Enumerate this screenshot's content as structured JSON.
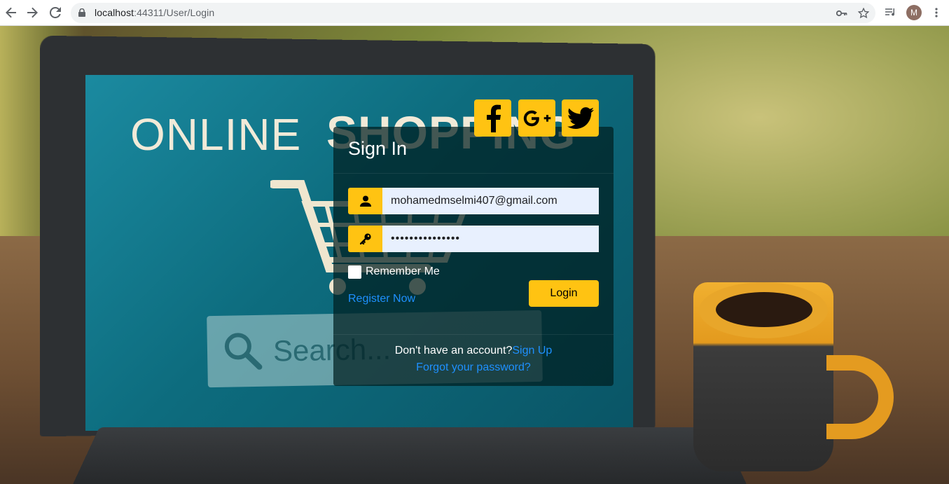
{
  "browser": {
    "url_host": "localhost",
    "url_rest": ":44311/User/Login",
    "profile_initial": "M"
  },
  "background": {
    "screen_text_online": "ONLINE",
    "screen_text_shopping": "SHOPPING",
    "screen_search_text": "Search..."
  },
  "login": {
    "title": "Sign In",
    "username_value": "mohamedmselmi407@gmail.com",
    "password_value": "•••••••••••••••",
    "remember_label": "Remember Me",
    "login_button": "Login",
    "register_link": "Register Now",
    "no_account_text": "Don't have an account?",
    "signup_link": "Sign Up",
    "forgot_link": "Forgot your password?"
  },
  "colors": {
    "accent": "#ffc312",
    "link": "#1e90ff",
    "panel": "rgba(0,30,32,0.72)"
  },
  "icons": {
    "social": [
      "facebook-icon",
      "google-plus-icon",
      "twitter-icon"
    ],
    "fields": [
      "user-icon",
      "key-icon"
    ]
  }
}
